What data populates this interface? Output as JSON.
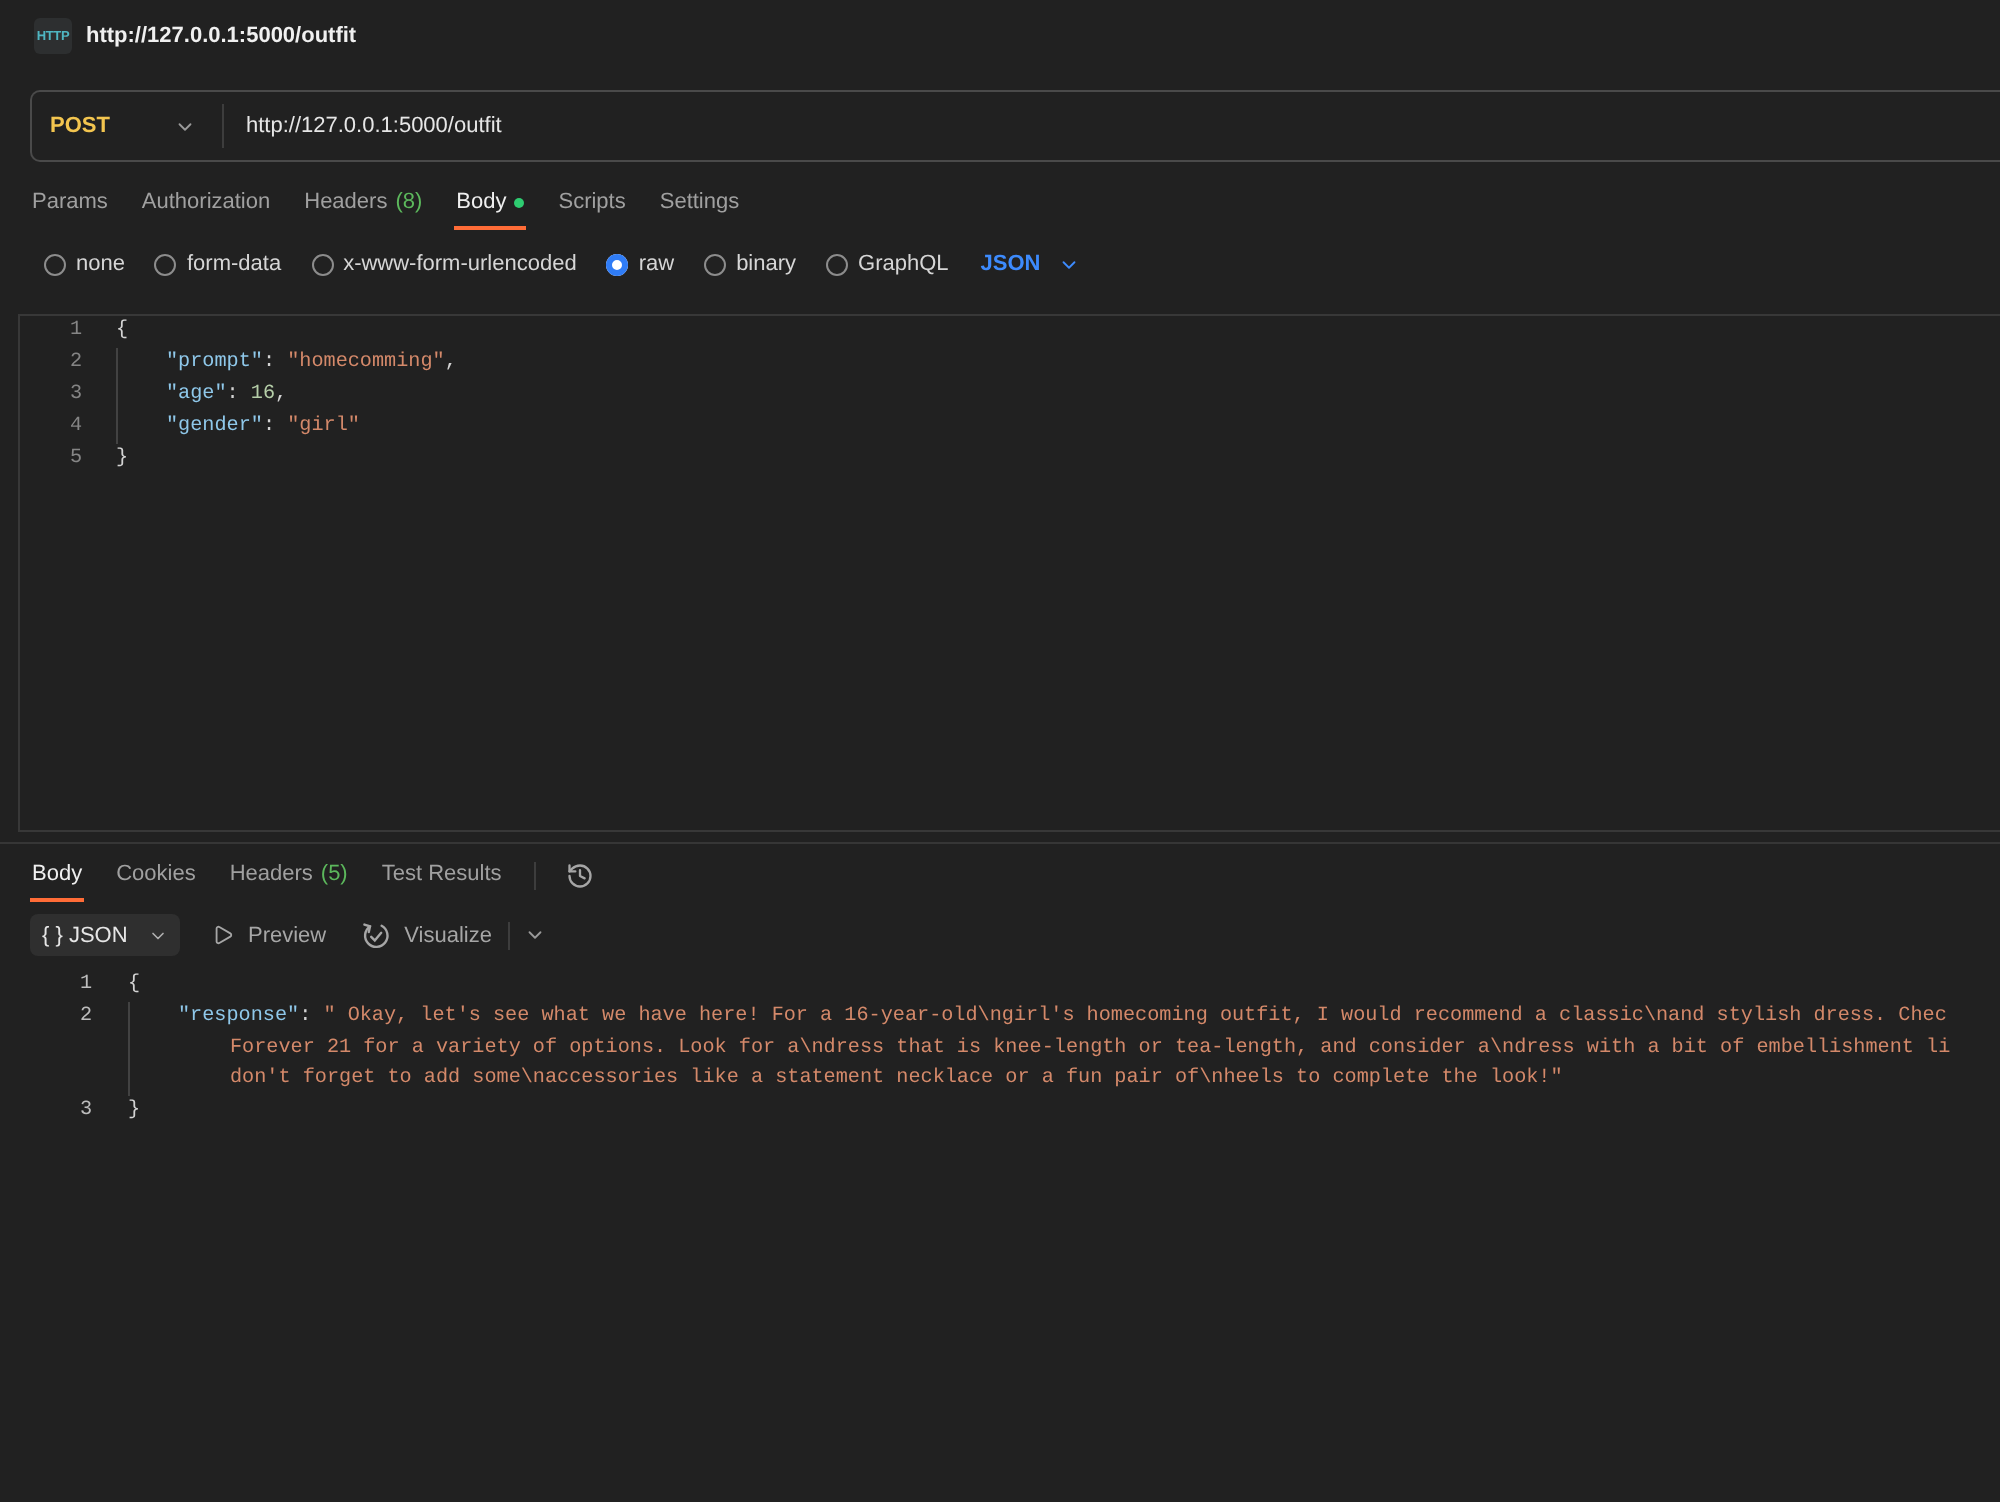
{
  "request": {
    "badge": "HTTP",
    "title": "http://127.0.0.1:5000/outfit"
  },
  "url_bar": {
    "method": "POST",
    "url": "http://127.0.0.1:5000/outfit"
  },
  "request_tabs": [
    {
      "label": "Params",
      "selected": false,
      "modified": false
    },
    {
      "label": "Authorization",
      "selected": false,
      "modified": false
    },
    {
      "label": "Headers",
      "count": "(8)",
      "selected": false,
      "modified": false
    },
    {
      "label": "Body",
      "selected": true,
      "modified": true
    },
    {
      "label": "Scripts",
      "selected": false,
      "modified": false
    },
    {
      "label": "Settings",
      "selected": false,
      "modified": false
    }
  ],
  "body_types": [
    {
      "label": "none",
      "selected": false
    },
    {
      "label": "form-data",
      "selected": false
    },
    {
      "label": "x-www-form-urlencoded",
      "selected": false
    },
    {
      "label": "raw",
      "selected": true
    },
    {
      "label": "binary",
      "selected": false
    },
    {
      "label": "GraphQL",
      "selected": false
    }
  ],
  "body_language": "JSON",
  "request_body": {
    "lines": [
      {
        "number": "1",
        "tokens": [
          {
            "kind": "punct",
            "text": "{"
          }
        ],
        "children": [
          {
            "number": "2",
            "tokens": [
              {
                "kind": "key",
                "text": "\"prompt\""
              },
              {
                "kind": "punct",
                "text": ": "
              },
              {
                "kind": "string",
                "text": "\"homecomming\""
              },
              {
                "kind": "punct",
                "text": ","
              }
            ]
          },
          {
            "number": "3",
            "tokens": [
              {
                "kind": "key",
                "text": "\"age\""
              },
              {
                "kind": "punct",
                "text": ": "
              },
              {
                "kind": "number",
                "text": "16"
              },
              {
                "kind": "punct",
                "text": ","
              }
            ]
          },
          {
            "number": "4",
            "tokens": [
              {
                "kind": "key",
                "text": "\"gender\""
              },
              {
                "kind": "punct",
                "text": ": "
              },
              {
                "kind": "string",
                "text": "\"girl\""
              }
            ]
          }
        ]
      },
      {
        "number": "5",
        "tokens": [
          {
            "kind": "punct",
            "text": "}"
          }
        ]
      }
    ]
  },
  "response_tabs": [
    {
      "label": "Body",
      "selected": true
    },
    {
      "label": "Cookies",
      "selected": false
    },
    {
      "label": "Headers",
      "count": "(5)",
      "selected": false
    },
    {
      "label": "Test Results",
      "selected": false
    }
  ],
  "response_toolbar": {
    "format": "{ } JSON",
    "actions": [
      {
        "kind": "preview",
        "label": "Preview"
      },
      {
        "kind": "visualize",
        "label": "Visualize"
      }
    ]
  },
  "response_body": {
    "lines": [
      {
        "number": "1",
        "tokens": [
          {
            "kind": "punct",
            "text": "{"
          }
        ],
        "children": [
          {
            "number": "2",
            "tokens": [
              {
                "kind": "key",
                "text": "\"response\""
              },
              {
                "kind": "punct",
                "text": ": "
              },
              {
                "kind": "string",
                "text": "\" Okay, let's see what we have here! For a 16-year-old\\ngirl's homecoming outfit, I would recommend a classic\\nand stylish dress. Chec"
              }
            ],
            "wrapped": [
              "Forever 21 for a variety of options. Look for a\\ndress that is knee-length or tea-length, and consider a\\ndress with a bit of embellishment li",
              "don't forget to add some\\naccessories like a statement necklace or a fun pair of\\nheels to complete the look!\""
            ]
          }
        ]
      },
      {
        "number": "3",
        "tokens": [
          {
            "kind": "punct",
            "text": "}"
          }
        ]
      }
    ]
  }
}
